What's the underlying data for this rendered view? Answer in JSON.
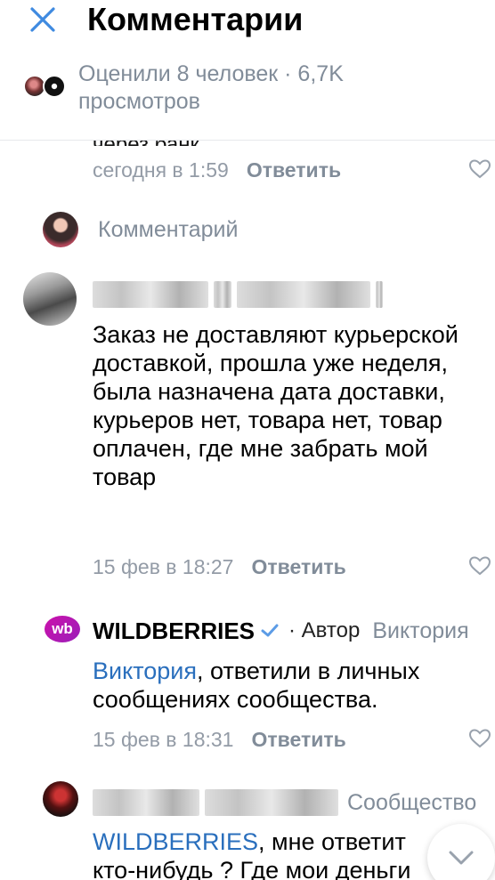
{
  "header": {
    "title": "Комментарии",
    "likes_text": "Оценили 8 человек · 6,7K просмотров"
  },
  "peek_text": "через банк.",
  "comments_prev": {
    "time": "сегодня в 1:59",
    "reply_label": "Ответить"
  },
  "compose": {
    "placeholder": "Комментарий"
  },
  "comment1": {
    "text": "Заказ не доставляют курьерской доставкой, прошла уже неделя, была назначена дата доставки, курьеров нет, товара нет, товар оплачен, где мне забрать мой товар",
    "time": "15 фев в 18:27",
    "reply_label": "Ответить"
  },
  "comment2": {
    "logo_text": "wb",
    "author": "WILDBERRIES",
    "author_tag": "· Автор",
    "reply_to": "Виктория",
    "mention": "Виктория",
    "text": ", ответили в личных сообщениях сообщества.",
    "time": "15 фев в 18:31",
    "reply_label": "Ответить"
  },
  "comment3": {
    "group_label": "Сообщество",
    "mention": "WILDBERRIES",
    "text": ", мне ответит кто-нибудь ? Где мои деньги ?!"
  },
  "colors": {
    "link": "#2a6fbd",
    "accent": "#3f8ae0",
    "muted": "#818c99",
    "brand": "#cb11ab"
  }
}
